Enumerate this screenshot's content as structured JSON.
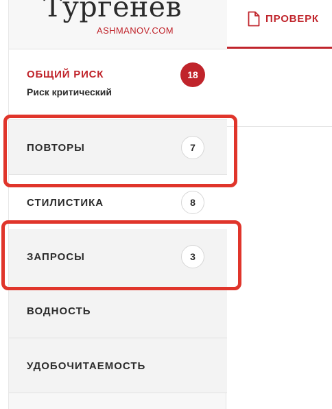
{
  "logo": {
    "title": "Тургенев",
    "subtitle": "ASHMANOV.COM"
  },
  "risk": {
    "title": "ОБЩИЙ РИСК",
    "subtitle": "Риск критический",
    "score": "18"
  },
  "nav": {
    "items": [
      {
        "label": "ПОВТОРЫ",
        "count": "7"
      },
      {
        "label": "СТИЛИСТИКА",
        "count": "8"
      },
      {
        "label": "ЗАПРОСЫ",
        "count": "3"
      },
      {
        "label": "ВОДНОСТЬ"
      },
      {
        "label": "УДОБОЧИТАЕМОСТЬ"
      }
    ]
  },
  "topbar": {
    "tab_label": "ПРОВЕРК",
    "tab_icon": "document-icon"
  },
  "colors": {
    "accent": "#c0242b",
    "highlight": "#e0352b",
    "sidebar_bg": "#f7f7f7"
  }
}
